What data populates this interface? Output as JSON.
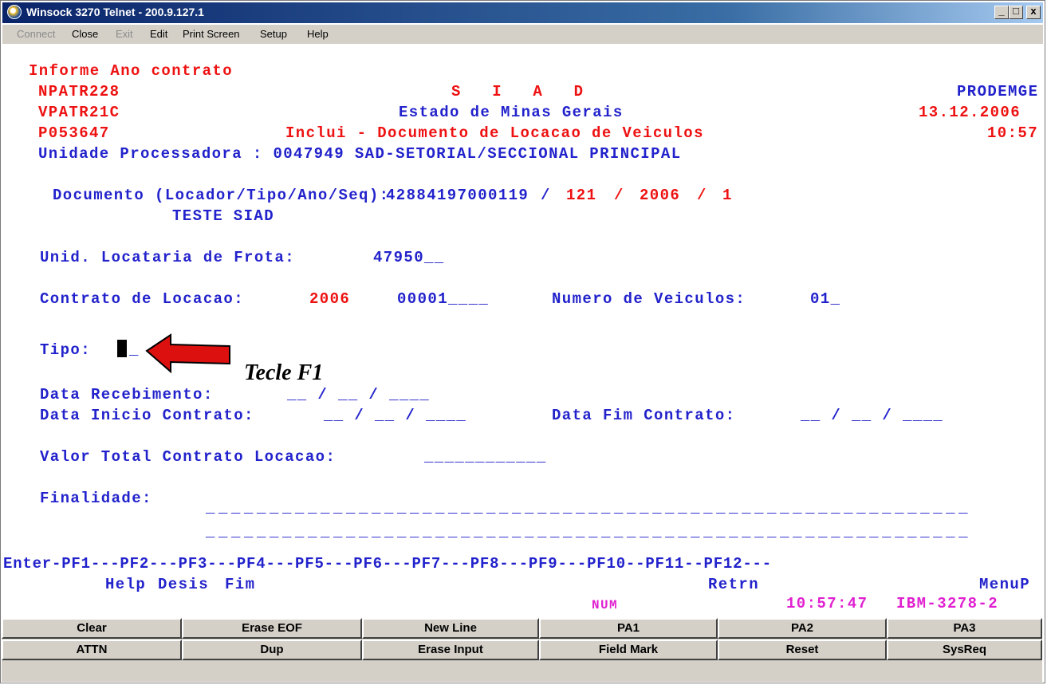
{
  "window": {
    "title": "Winsock 3270 Telnet - 200.9.127.1",
    "minimize_glyph": "_",
    "maximize_glyph": "□",
    "close_glyph": "x"
  },
  "menu": {
    "connect": "Connect",
    "close": "Close",
    "exit": "Exit",
    "edit": "Edit",
    "print_screen": "Print Screen",
    "setup": "Setup",
    "help": "Help"
  },
  "screen": {
    "message": "Informe Ano contrato",
    "row1": {
      "left": "NPATR228",
      "center": "S   I   A   D",
      "right": "PRODEMGE"
    },
    "row2": {
      "left": "VPATR21C",
      "center": "Estado de Minas Gerais",
      "right": "13.12.2006"
    },
    "row3": {
      "left": "P053647",
      "center": "Inclui - Documento de Locacao de Veiculos",
      "right": "10:57"
    },
    "unidade": "Unidade Processadora : 0047949 SAD-SETORIAL/SECCIONAL PRINCIPAL",
    "documento": {
      "label": "Documento (Locador/Tipo/Ano/Seq):",
      "locador": "42884197000119",
      "sep": "/",
      "tipo": "121",
      "ano": "2006",
      "seq": "1"
    },
    "documento_desc": "TESTE SIAD",
    "unid_locataria": {
      "label": "Unid. Locataria de Frota:",
      "value": "47950__"
    },
    "contrato": {
      "label": "Contrato de Locacao:",
      "ano": "2006",
      "numero": "00001____",
      "veiculos_label": "Numero de Veiculos:",
      "veiculos_value": "01_"
    },
    "tipo": {
      "label": "Tipo:",
      "value": "_"
    },
    "data_recebimento": {
      "label": "Data Recebimento:",
      "value": "__ / __ / ____"
    },
    "data_inicio": {
      "label": "Data Inicio Contrato:",
      "value": "__ / __ / ____"
    },
    "data_fim": {
      "label": "Data Fim Contrato:",
      "value": "__ / __ / ____"
    },
    "valor_total": {
      "label": "Valor Total Contrato Locacao:",
      "value": "____________"
    },
    "finalidade": {
      "label": "Finalidade:",
      "line1": "____________________________________________________________",
      "line2": "____________________________________________________________"
    },
    "pf_line": "Enter-PF1---PF2---PF3---PF4---PF5---PF6---PF7---PF8---PF9---PF10--PF11--PF12---",
    "pf_labels": {
      "help": "Help",
      "desis": "Desis",
      "fim": "Fim",
      "retrn": "Retrn",
      "menup": "MenuP"
    },
    "status": {
      "num": "NUM",
      "clock": "10:57:47",
      "terminal": "IBM-3278-2"
    }
  },
  "annotation": {
    "text": "Tecle F1"
  },
  "keypad": {
    "row1": [
      "Clear",
      "Erase EOF",
      "New Line",
      "PA1",
      "PA2",
      "PA3"
    ],
    "row2": [
      "ATTN",
      "Dup",
      "Erase Input",
      "Field Mark",
      "Reset",
      "SysReq"
    ]
  },
  "colors": {
    "field_blue": "#2222cc",
    "protected_red": "#ee1111",
    "status_pink": "#e020d0",
    "titlebar": "#0a246a"
  }
}
